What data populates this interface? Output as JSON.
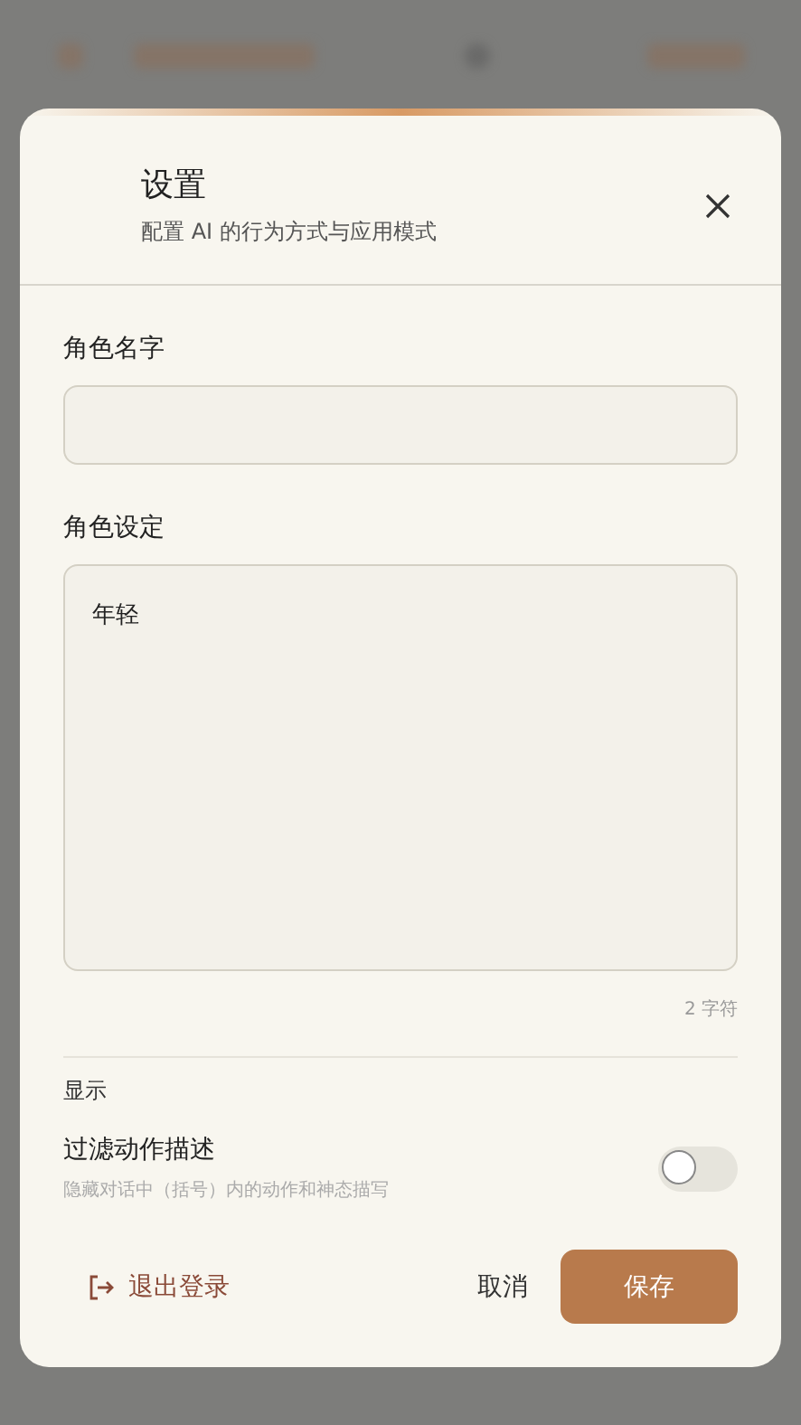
{
  "dialog": {
    "title": "设置",
    "subtitle": "配置 AI 的行为方式与应用模式"
  },
  "fields": [
    {
      "kind": "input",
      "label": "角色名字"
    },
    {
      "kind": "textarea",
      "label": "角色设定",
      "value": "年轻",
      "count": "2 字符"
    }
  ],
  "section": "显示",
  "toggle": {
    "label": "过滤动作描述",
    "description": "隐藏对话中（括号）内的动作和神态描写",
    "on": false
  },
  "footer": {
    "logout": "退出登录",
    "cancel": "取消",
    "save": "保存"
  }
}
